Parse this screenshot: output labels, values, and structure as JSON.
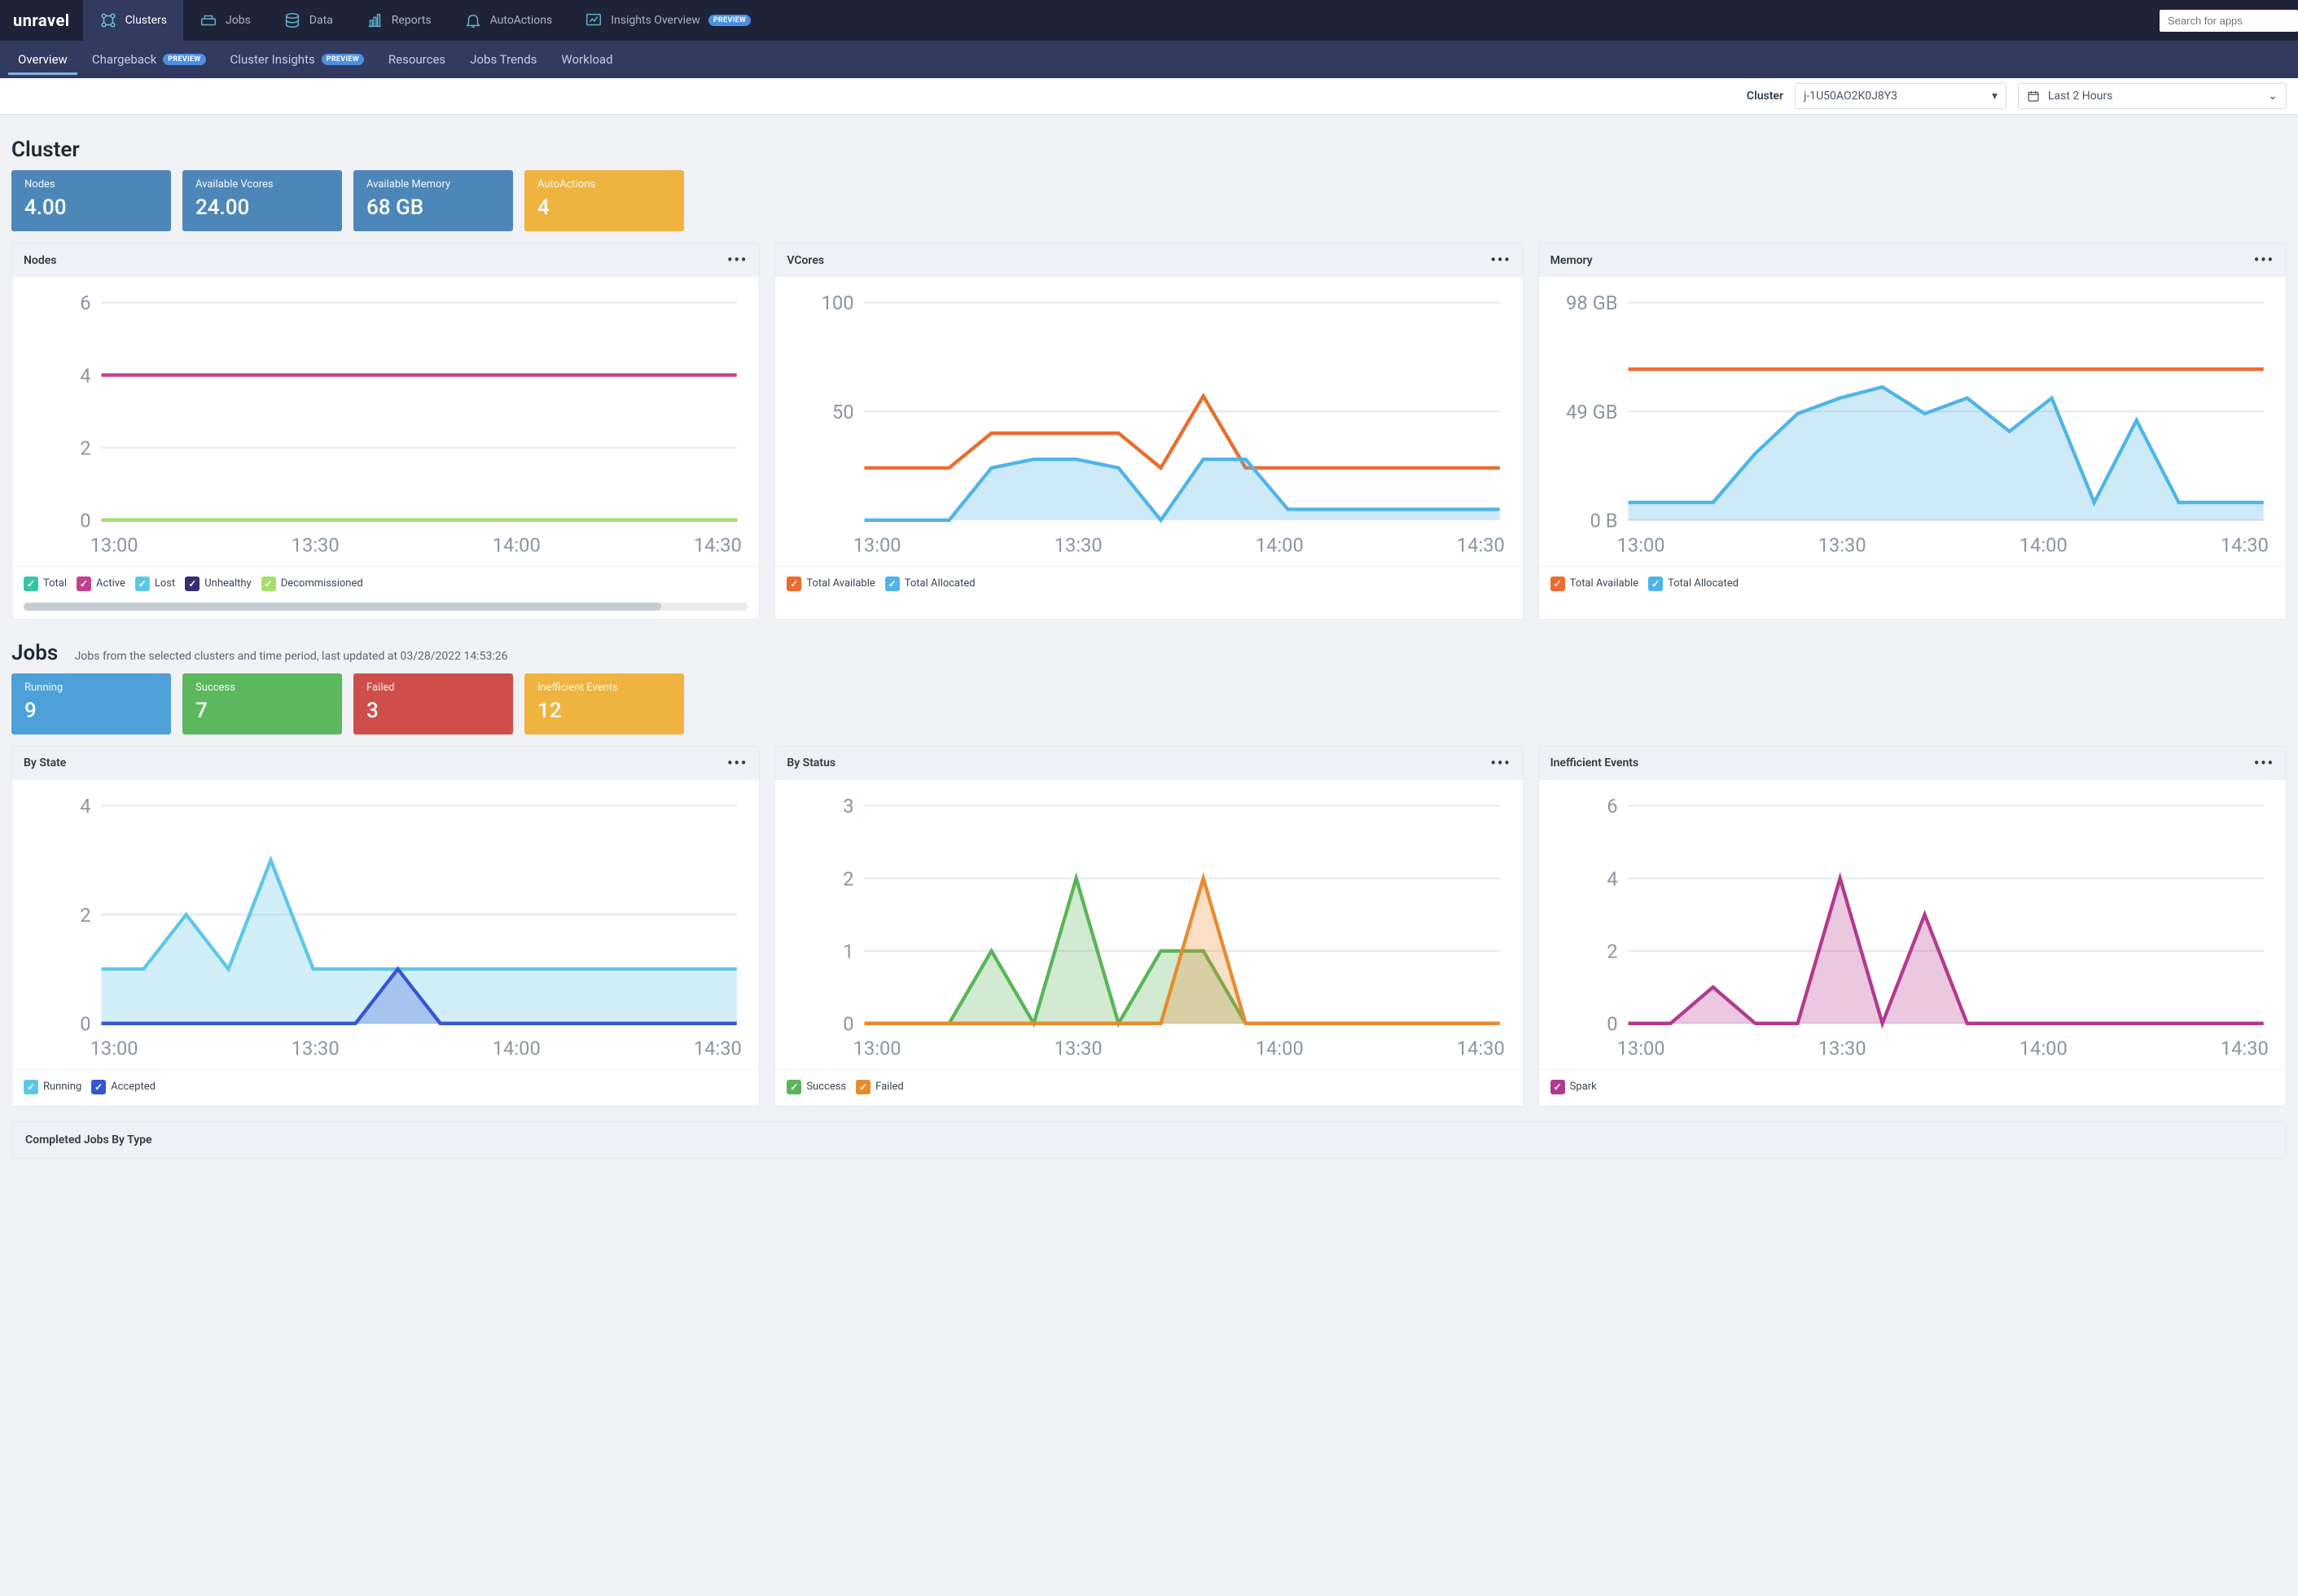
{
  "brand": "unravel",
  "nav": {
    "items": [
      {
        "label": "Clusters",
        "icon": "cluster"
      },
      {
        "label": "Jobs",
        "icon": "jobs"
      },
      {
        "label": "Data",
        "icon": "data"
      },
      {
        "label": "Reports",
        "icon": "reports"
      },
      {
        "label": "AutoActions",
        "icon": "bell"
      },
      {
        "label": "Insights Overview",
        "icon": "insights",
        "preview": true
      }
    ],
    "preview_badge": "PREVIEW",
    "search_placeholder": "Search for apps"
  },
  "subnav": {
    "items": [
      {
        "label": "Overview",
        "active": true
      },
      {
        "label": "Chargeback",
        "preview": true
      },
      {
        "label": "Cluster Insights",
        "preview": true
      },
      {
        "label": "Resources"
      },
      {
        "label": "Jobs Trends"
      },
      {
        "label": "Workload"
      }
    ]
  },
  "filter": {
    "cluster_label": "Cluster",
    "cluster_value": "j-1U50AO2K0J8Y3",
    "time_value": "Last 2 Hours"
  },
  "cluster_section": {
    "title": "Cluster",
    "metrics": [
      {
        "label": "Nodes",
        "value": "4.00",
        "color": "steel"
      },
      {
        "label": "Available Vcores",
        "value": "24.00",
        "color": "steel"
      },
      {
        "label": "Available Memory",
        "value": "68 GB",
        "color": "steel"
      },
      {
        "label": "AutoActions",
        "value": "4",
        "color": "amber"
      }
    ],
    "charts": {
      "nodes": {
        "title": "Nodes",
        "legend": [
          {
            "label": "Total",
            "color": "#34c5a5"
          },
          {
            "label": "Active",
            "color": "#c2418f"
          },
          {
            "label": "Lost",
            "color": "#5ec7e8"
          },
          {
            "label": "Unhealthy",
            "color": "#3a2e6e"
          },
          {
            "label": "Decommissioned",
            "color": "#a6e06a"
          }
        ]
      },
      "vcores": {
        "title": "VCores",
        "legend": [
          {
            "label": "Total Available",
            "color": "#ec6b2d"
          },
          {
            "label": "Total Allocated",
            "color": "#4fb4e8"
          }
        ]
      },
      "memory": {
        "title": "Memory",
        "legend": [
          {
            "label": "Total Available",
            "color": "#ec6b2d"
          },
          {
            "label": "Total Allocated",
            "color": "#4fb4e8"
          }
        ]
      }
    }
  },
  "jobs_section": {
    "title": "Jobs",
    "subtitle": "Jobs from the selected clusters and time period, last updated at 03/28/2022 14:53:26",
    "metrics": [
      {
        "label": "Running",
        "value": "9",
        "color": "blue"
      },
      {
        "label": "Success",
        "value": "7",
        "color": "green"
      },
      {
        "label": "Failed",
        "value": "3",
        "color": "red"
      },
      {
        "label": "Inefficient Events",
        "value": "12",
        "color": "amber"
      }
    ],
    "charts": {
      "by_state": {
        "title": "By State",
        "legend": [
          {
            "label": "Running",
            "color": "#5ec7e8"
          },
          {
            "label": "Accepted",
            "color": "#3756d4"
          }
        ]
      },
      "by_status": {
        "title": "By Status",
        "legend": [
          {
            "label": "Success",
            "color": "#59b559"
          },
          {
            "label": "Failed",
            "color": "#e88b2f"
          }
        ]
      },
      "inefficient": {
        "title": "Inefficient Events",
        "legend": [
          {
            "label": "Spark",
            "color": "#b23a8e"
          }
        ]
      }
    },
    "completed_title": "Completed Jobs By Type"
  },
  "chart_data": [
    {
      "id": "nodes",
      "type": "line",
      "x_ticks": [
        "13:00",
        "13:30",
        "14:00",
        "14:30"
      ],
      "ylim": [
        0,
        6
      ],
      "y_ticks": [
        0,
        2,
        4,
        6
      ],
      "series": [
        {
          "name": "Total",
          "color": "#34c5a5",
          "values": [
            0,
            0,
            0,
            0,
            0,
            0,
            0,
            0,
            0,
            0
          ]
        },
        {
          "name": "Active",
          "color": "#c2418f",
          "values": [
            4,
            4,
            4,
            4,
            4,
            4,
            4,
            4,
            4,
            4
          ]
        },
        {
          "name": "Lost",
          "color": "#5ec7e8",
          "values": [
            0,
            0,
            0,
            0,
            0,
            0,
            0,
            0,
            0,
            0
          ]
        },
        {
          "name": "Unhealthy",
          "color": "#3a2e6e",
          "values": [
            0,
            0,
            0,
            0,
            0,
            0,
            0,
            0,
            0,
            0
          ]
        },
        {
          "name": "Decommissioned",
          "color": "#a6e06a",
          "values": [
            0,
            0,
            0,
            0,
            0,
            0,
            0,
            0,
            0,
            0
          ]
        }
      ]
    },
    {
      "id": "vcores",
      "type": "area",
      "x_ticks": [
        "13:00",
        "13:30",
        "14:00",
        "14:30"
      ],
      "ylim": [
        0,
        100
      ],
      "y_ticks": [
        50,
        100
      ],
      "series": [
        {
          "name": "Total Available",
          "color": "#ec6b2d",
          "area": false,
          "values": [
            24,
            24,
            24,
            40,
            40,
            40,
            40,
            24,
            57,
            24,
            24,
            24,
            24,
            24,
            24,
            24
          ]
        },
        {
          "name": "Total Allocated",
          "color": "#4fb4e8",
          "area": true,
          "values": [
            0,
            0,
            0,
            24,
            28,
            28,
            24,
            0,
            28,
            28,
            5,
            5,
            5,
            5,
            5,
            5
          ]
        }
      ]
    },
    {
      "id": "memory",
      "type": "area",
      "x_ticks": [
        "13:00",
        "13:30",
        "14:00",
        "14:30"
      ],
      "y_tick_labels": [
        "0 B",
        "49 GB",
        "98 GB"
      ],
      "ylim": [
        0,
        98
      ],
      "y_ticks": [
        0,
        49,
        98
      ],
      "series": [
        {
          "name": "Total Available",
          "color": "#ec6b2d",
          "area": false,
          "values": [
            68,
            68,
            68,
            68,
            68,
            68,
            68,
            68,
            68,
            68,
            68,
            68,
            68,
            68,
            68,
            68
          ]
        },
        {
          "name": "Total Allocated",
          "color": "#4fb4e8",
          "area": true,
          "values": [
            8,
            8,
            8,
            30,
            48,
            55,
            60,
            48,
            55,
            40,
            55,
            8,
            45,
            8,
            8,
            8
          ]
        }
      ]
    },
    {
      "id": "by_state",
      "type": "area",
      "x_ticks": [
        "13:00",
        "13:30",
        "14:00",
        "14:30"
      ],
      "ylim": [
        0,
        4
      ],
      "y_ticks": [
        0,
        2,
        4
      ],
      "series": [
        {
          "name": "Running",
          "color": "#5ec7e8",
          "area": true,
          "values": [
            1,
            1,
            2,
            1,
            3,
            1,
            1,
            1,
            1,
            1,
            1,
            1,
            1,
            1,
            1,
            1
          ]
        },
        {
          "name": "Accepted",
          "color": "#3756d4",
          "area": true,
          "values": [
            0,
            0,
            0,
            0,
            0,
            0,
            0,
            1,
            0,
            0,
            0,
            0,
            0,
            0,
            0,
            0
          ]
        }
      ]
    },
    {
      "id": "by_status",
      "type": "area",
      "x_ticks": [
        "13:00",
        "13:30",
        "14:00",
        "14:30"
      ],
      "ylim": [
        0,
        3
      ],
      "y_ticks": [
        0,
        1,
        2,
        3
      ],
      "series": [
        {
          "name": "Success",
          "color": "#59b559",
          "area": true,
          "values": [
            0,
            0,
            0,
            1,
            0,
            2,
            0,
            1,
            1,
            0,
            0,
            0,
            0,
            0,
            0,
            0
          ]
        },
        {
          "name": "Failed",
          "color": "#e88b2f",
          "area": true,
          "values": [
            0,
            0,
            0,
            0,
            0,
            0,
            0,
            0,
            2,
            0,
            0,
            0,
            0,
            0,
            0,
            0
          ]
        }
      ]
    },
    {
      "id": "inefficient",
      "type": "area",
      "x_ticks": [
        "13:00",
        "13:30",
        "14:00",
        "14:30"
      ],
      "ylim": [
        0,
        6
      ],
      "y_ticks": [
        0,
        2,
        4,
        6
      ],
      "series": [
        {
          "name": "Spark",
          "color": "#b23a8e",
          "area": true,
          "values": [
            0,
            0,
            1,
            0,
            0,
            4,
            0,
            3,
            0,
            0,
            0,
            0,
            0,
            0,
            0,
            0
          ]
        }
      ]
    }
  ]
}
